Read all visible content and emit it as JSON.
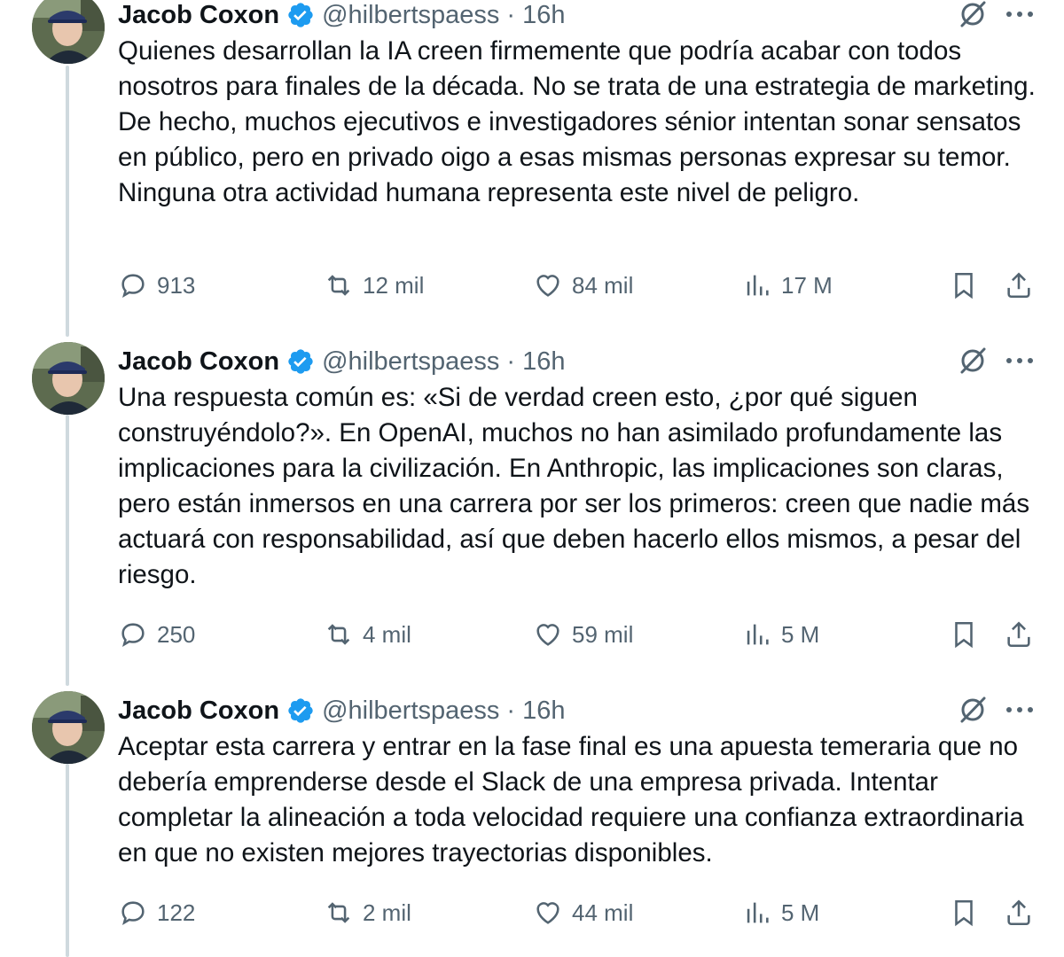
{
  "tweets": [
    {
      "author": "Jacob Coxon",
      "handle": "@hilbertspaess",
      "separator": "·",
      "time": "16h",
      "text": "Quienes desarrollan la IA creen firmemente que podría acabar con todos nosotros para finales de la década. No se trata de una estrategia de marketing. De hecho, muchos ejecutivos e investigadores sénior intentan sonar sensatos en público, pero en privado oigo a esas mismas personas expresar su temor. Ninguna otra actividad humana representa este nivel de peligro.",
      "replies": "913",
      "retweets": "12 mil",
      "likes": "84 mil",
      "views": "17 M"
    },
    {
      "author": "Jacob Coxon",
      "handle": "@hilbertspaess",
      "separator": "·",
      "time": "16h",
      "text": "Una respuesta común es: «Si de verdad creen esto, ¿por qué siguen construyéndolo?». En OpenAI, muchos no han asimilado profundamente las implicaciones para la civilización. En Anthropic, las implicaciones son claras, pero están inmersos en una carrera por ser los primeros: creen que nadie más actuará con responsabilidad, así que deben hacerlo ellos mismos, a pesar del riesgo.",
      "replies": "250",
      "retweets": "4 mil",
      "likes": "59 mil",
      "views": "5 M"
    },
    {
      "author": "Jacob Coxon",
      "handle": "@hilbertspaess",
      "separator": "·",
      "time": "16h",
      "text": "Aceptar esta carrera y entrar en la fase final es una apuesta temeraria que no debería emprenderse desde el Slack de una empresa privada. Intentar completar la alineación a toda velocidad requiere una confianza extraordinaria en que no existen mejores trayectorias disponibles.",
      "replies": "122",
      "retweets": "2 mil",
      "likes": "44 mil",
      "views": "5 M"
    }
  ],
  "icons": {
    "verified": "verified-badge-icon",
    "grok": "grok-icon",
    "more": "more-icon",
    "reply": "reply-icon",
    "retweet": "retweet-icon",
    "like": "like-icon",
    "views": "views-icon",
    "bookmark": "bookmark-icon",
    "share": "share-icon"
  },
  "colors": {
    "text": "#0f1419",
    "secondary": "#536471",
    "verified": "#1d9bf0",
    "thread_line": "#cfd9de"
  }
}
